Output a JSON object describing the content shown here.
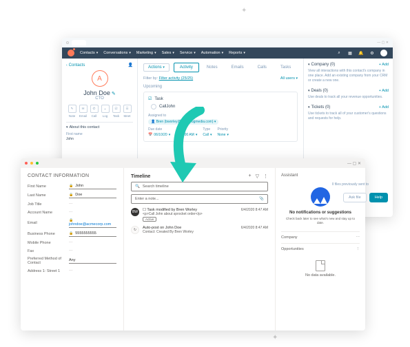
{
  "hubspot": {
    "nav": [
      "Contacts",
      "Conversations",
      "Marketing",
      "Sales",
      "Service",
      "Automation",
      "Reports"
    ],
    "back": "Contacts",
    "contact": {
      "initials": "A",
      "name": "John Doe",
      "title": "CTO"
    },
    "actions": [
      {
        "label": "Note",
        "icon": "✎"
      },
      {
        "label": "Email",
        "icon": "✉"
      },
      {
        "label": "Call",
        "icon": "✆"
      },
      {
        "label": "Log",
        "icon": "+"
      },
      {
        "label": "Task",
        "icon": "☑"
      },
      {
        "label": "Meet",
        "icon": "☰"
      }
    ],
    "about_header": "About this contact",
    "about": {
      "firstname_label": "First name",
      "firstname": "John"
    },
    "actions_btn": "Actions",
    "tabs": [
      "Activity",
      "Notes",
      "Emails",
      "Calls",
      "Tasks"
    ],
    "filter_prefix": "Filter by:",
    "filter_link": "Filter activity (25/25)",
    "all_users": "All users",
    "upcoming": "Upcoming",
    "task": {
      "header": "Task",
      "title": "CallJohn",
      "assigned_label": "Assigned to",
      "assigned_to": "(bworley@smartbugmedia.com)",
      "date_label": "Due date",
      "date": "06/10/20",
      "time": "8:00 AM",
      "type_label": "Type",
      "type": "Call",
      "priority_label": "Priority",
      "priority": "None"
    },
    "right": {
      "company": {
        "title": "Company (0)",
        "add": "+ Add",
        "body": "View all interactions with this contact's company in one place. Add an existing company from your CRM or create a new one."
      },
      "deals": {
        "title": "Deals (0)",
        "add": "+ Add",
        "body": "Use deals to track all your revenue opportunities."
      },
      "tickets": {
        "title": "Tickets (0)",
        "add": "+ Add",
        "body": "Use tickets to track all of your customer's questions and requests for help."
      }
    }
  },
  "dynamics": {
    "left_header": "CONTACT INFORMATION",
    "fields": [
      {
        "label": "First Name",
        "value": "John",
        "lock": true,
        "filled": true
      },
      {
        "label": "Last Name",
        "value": "Doe",
        "lock": true,
        "filled": true
      },
      {
        "label": "Job Title",
        "value": "",
        "filled": false
      },
      {
        "label": "Account Name",
        "value": "",
        "filled": false
      },
      {
        "label": "Email",
        "value": "johndoe@acmecorp.com",
        "lock": true,
        "filled": true,
        "link": true
      },
      {
        "label": "Business Phone",
        "value": "5555555555",
        "lock": true,
        "filled": true
      },
      {
        "label": "Mobile Phone",
        "value": "",
        "filled": false
      },
      {
        "label": "Fax",
        "value": "",
        "filled": false
      },
      {
        "label": "Preferred Method of Contact",
        "value": "Any",
        "filled": true
      },
      {
        "label": "Address 1: Street 1",
        "value": "",
        "filled": false
      }
    ],
    "timeline": {
      "title": "Timeline",
      "search": "Search timeline",
      "note": "Enter a note...",
      "items": [
        {
          "icon": "BW",
          "title": "Task modified by Bren Worley",
          "sub": "<p>Call John about sprocket order</p>",
          "badge": "Active",
          "time": "6/4/2020 8:47 AM"
        },
        {
          "icon": "↻",
          "title": "Auto-post on John Doe",
          "sub": "Contact: Created By Bren Worley",
          "time": "6/4/2020 8:47 AM",
          "light": true
        }
      ]
    },
    "assistant": {
      "header": "Assistant",
      "title": "No notifications or suggestions",
      "sub": "Check back later to see what's new and stay up to date."
    },
    "company_label": "Company",
    "opps_label": "Opportunities",
    "nodata": "No data available."
  },
  "float": {
    "text": "ll files previously sent to",
    "askfile": "Ask file",
    "help": "Help"
  }
}
